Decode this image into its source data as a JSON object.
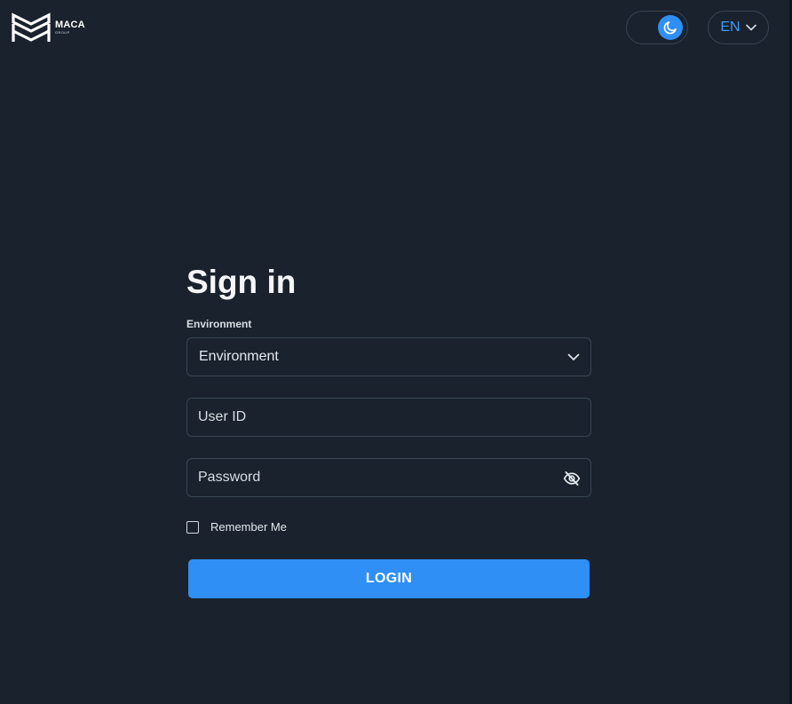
{
  "header": {
    "logo": {
      "name": "MACA",
      "subtitle": "GROUP",
      "icon": "maca-chevron-logo"
    },
    "theme_toggle": {
      "mode": "dark",
      "icon": "moon-icon"
    },
    "language": {
      "selected": "EN",
      "icon": "chevron-down-icon"
    }
  },
  "signin": {
    "title": "Sign in",
    "environment_label": "Environment",
    "environment_value": "Environment",
    "user_id_placeholder": "User ID",
    "password_placeholder": "Password",
    "password_visibility_icon": "eye-off-icon",
    "remember_me_label": "Remember Me",
    "remember_me_checked": false,
    "login_label": "LOGIN"
  },
  "colors": {
    "background": "#19222d",
    "accent": "#2f8ff4",
    "border": "#3a4654",
    "text": "#e8edf3"
  }
}
